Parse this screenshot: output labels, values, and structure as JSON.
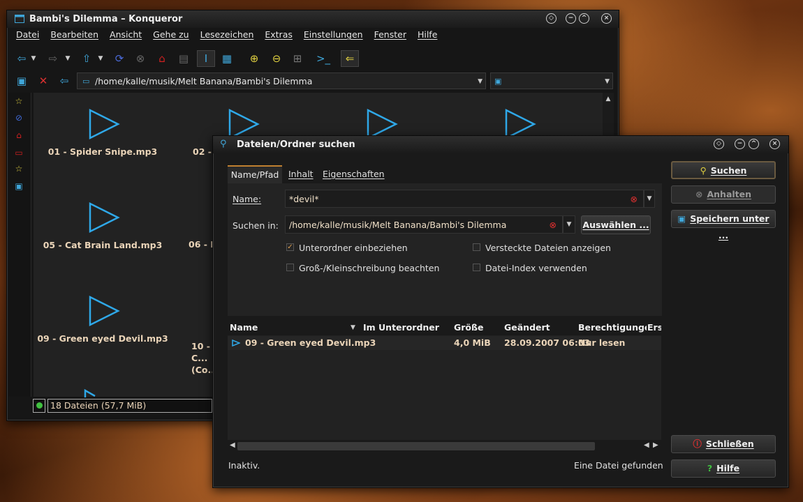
{
  "konqueror": {
    "title": "Bambi's Dilemma – Konqueror",
    "menu": [
      "Datei",
      "Bearbeiten",
      "Ansicht",
      "Gehe zu",
      "Lesezeichen",
      "Extras",
      "Einstellungen",
      "Fenster",
      "Hilfe"
    ],
    "location": "/home/kalle/musik/Melt Banana/Bambi's Dilemma",
    "files": [
      {
        "label": "01 - Spider Snipe.mp3"
      },
      {
        "label": "02 - ..."
      },
      {
        "label": "05 - Cat Brain Land.mp3"
      },
      {
        "label": "06 - P..."
      },
      {
        "label": "09 - Green eyed Devil.mp3"
      },
      {
        "label": "10 - C... (Co..."
      }
    ],
    "status": "18 Dateien (57,7 MiB)"
  },
  "dialog": {
    "title": "Dateien/Ordner suchen",
    "tabs": [
      "Name/Pfad",
      "Inhalt",
      "Eigenschaften"
    ],
    "name_label": "Name:",
    "name_value": "*devil*",
    "searchin_label": "Suchen in:",
    "searchin_value": "/home/kalle/musik/Melt Banana/Bambi's Dilemma",
    "choose_button": "Auswählen ...",
    "checkboxes": {
      "subfolders": "Unterordner einbeziehen",
      "hidden": "Versteckte Dateien anzeigen",
      "case": "Groß-/Kleinschreibung beachten",
      "index": "Datei-Index verwenden"
    },
    "columns": [
      "Name",
      "Im Unterordner",
      "Größe",
      "Geändert",
      "Berechtigungen",
      "Ers"
    ],
    "results": [
      {
        "name": "09 - Green eyed Devil.mp3",
        "subfolder": "",
        "size": "4,0 MiB",
        "modified": "28.09.2007 06:03",
        "permissions": "Nur lesen"
      }
    ],
    "status_left": "Inaktiv.",
    "status_right": "Eine Datei gefunden",
    "buttons": {
      "search": "Suchen",
      "stop": "Anhalten",
      "save": "Speichern unter ...",
      "close": "Schließen",
      "help": "Hilfe"
    }
  },
  "colors": {
    "accent": "#3fa6d9",
    "file_text": "#ead4b8"
  }
}
